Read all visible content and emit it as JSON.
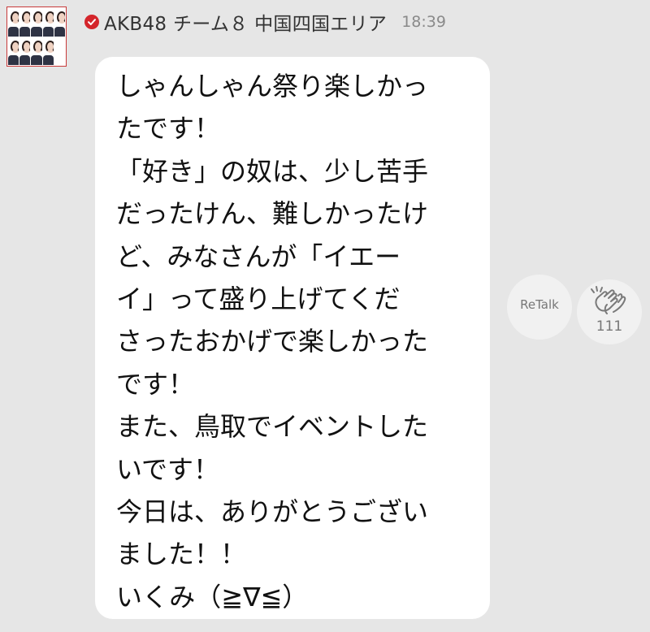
{
  "header": {
    "sender_name": "AKB48 チーム８ 中国四国エリア",
    "timestamp": "18:39",
    "verified_icon": "verified-check-icon",
    "verified_color": "#d4252b"
  },
  "message": {
    "lines": [
      "しゃんしゃん祭り楽しかっ",
      "たです！",
      "「好き」の奴は、少し苦手",
      "だったけん、難しかったけ",
      "ど、みなさんが「イエー",
      "イ」って盛り上げてくだ",
      "さったおかげで楽しかった",
      "です！",
      "また、鳥取でイベントした",
      "いです！",
      "今日は、ありがとうござい",
      "ました！！",
      "いくみ（≧∇≦）"
    ]
  },
  "actions": {
    "retalk_label": "ReTalk",
    "clap_icon": "clap-hands-icon",
    "clap_count": "111"
  },
  "colors": {
    "background": "#e6e6e6",
    "bubble": "#ffffff",
    "action_circle": "#f1f1f1"
  }
}
